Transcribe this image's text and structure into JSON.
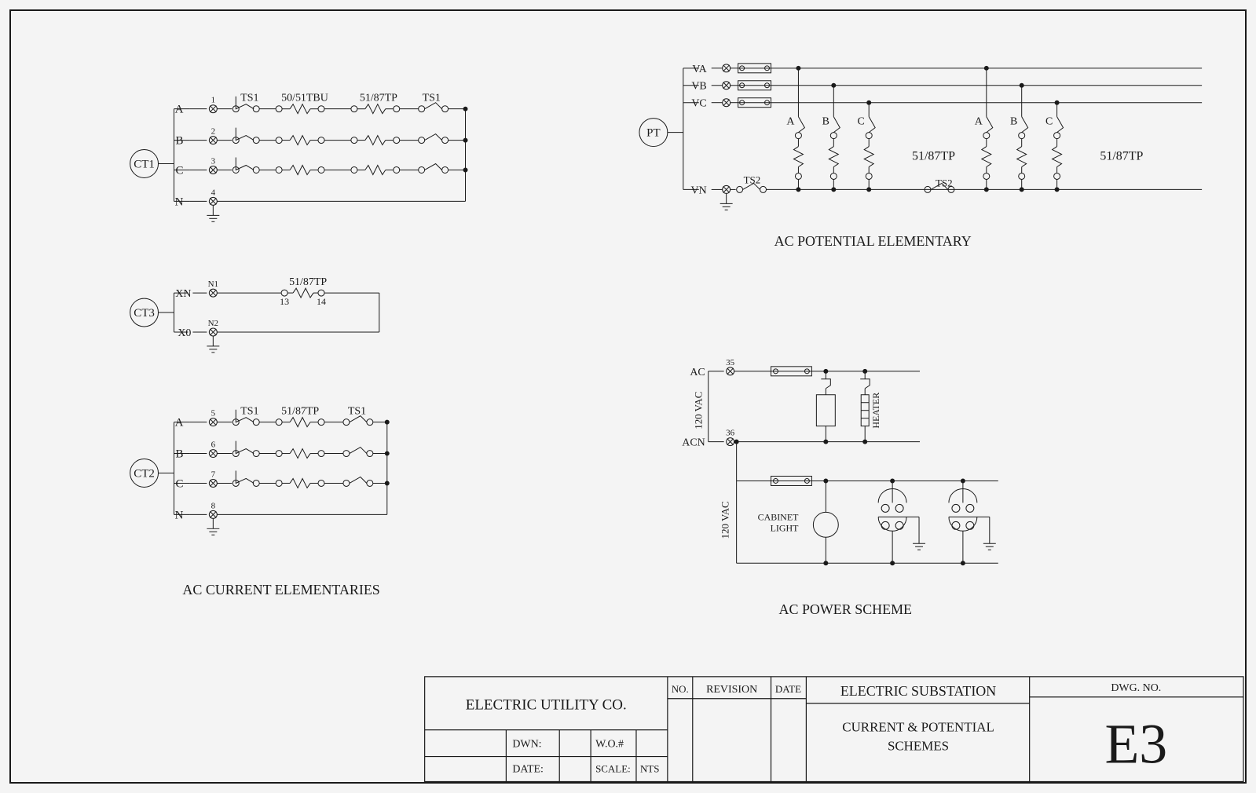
{
  "ct1": {
    "label": "CT1",
    "phases": [
      {
        "name": "A",
        "num": "1"
      },
      {
        "name": "B",
        "num": "2"
      },
      {
        "name": "C",
        "num": "3"
      },
      {
        "name": "N",
        "num": "4"
      }
    ],
    "ts_left": "TS1",
    "relay1": "50/51TBU",
    "relay2": "51/87TP",
    "ts_right": "TS1"
  },
  "ct3": {
    "label": "CT3",
    "xn": {
      "name": "XN",
      "num": "N1"
    },
    "x0": {
      "name": "X0",
      "num": "N2"
    },
    "relay": "51/87TP",
    "term_a": "13",
    "term_b": "14"
  },
  "ct2": {
    "label": "CT2",
    "phases": [
      {
        "name": "A",
        "num": "5"
      },
      {
        "name": "B",
        "num": "6"
      },
      {
        "name": "C",
        "num": "7"
      },
      {
        "name": "N",
        "num": "8"
      }
    ],
    "ts_left": "TS1",
    "relay": "51/87TP",
    "ts_right": "TS1"
  },
  "titles": {
    "current": "AC CURRENT ELEMENTARIES",
    "potential": "AC POTENTIAL ELEMENTARY",
    "power": "AC POWER SCHEME"
  },
  "pt": {
    "label": "PT",
    "rows": [
      "VA",
      "VB",
      "VC",
      "VN"
    ],
    "phase_labels": [
      "A",
      "B",
      "C"
    ],
    "relay": "51/87TP",
    "ts2": "TS2"
  },
  "power": {
    "ac": {
      "name": "AC",
      "num": "35"
    },
    "acn": {
      "name": "ACN",
      "num": "36"
    },
    "volt": "120 VAC",
    "heater": "HEATER",
    "light": "CABINET\nLIGHT"
  },
  "titleblock": {
    "company": "ELECTRIC UTILITY CO.",
    "dwn": "DWN:",
    "date": "DATE:",
    "wo": "W.O.#",
    "scale_label": "SCALE:",
    "scale_val": "NTS",
    "no": "NO.",
    "revision": "REVISION",
    "date_col": "DATE",
    "project": "ELECTRIC SUBSTATION",
    "sheet1": "CURRENT & POTENTIAL",
    "sheet2": "SCHEMES",
    "dwg_no_label": "DWG. NO.",
    "dwg_no": "E3"
  }
}
